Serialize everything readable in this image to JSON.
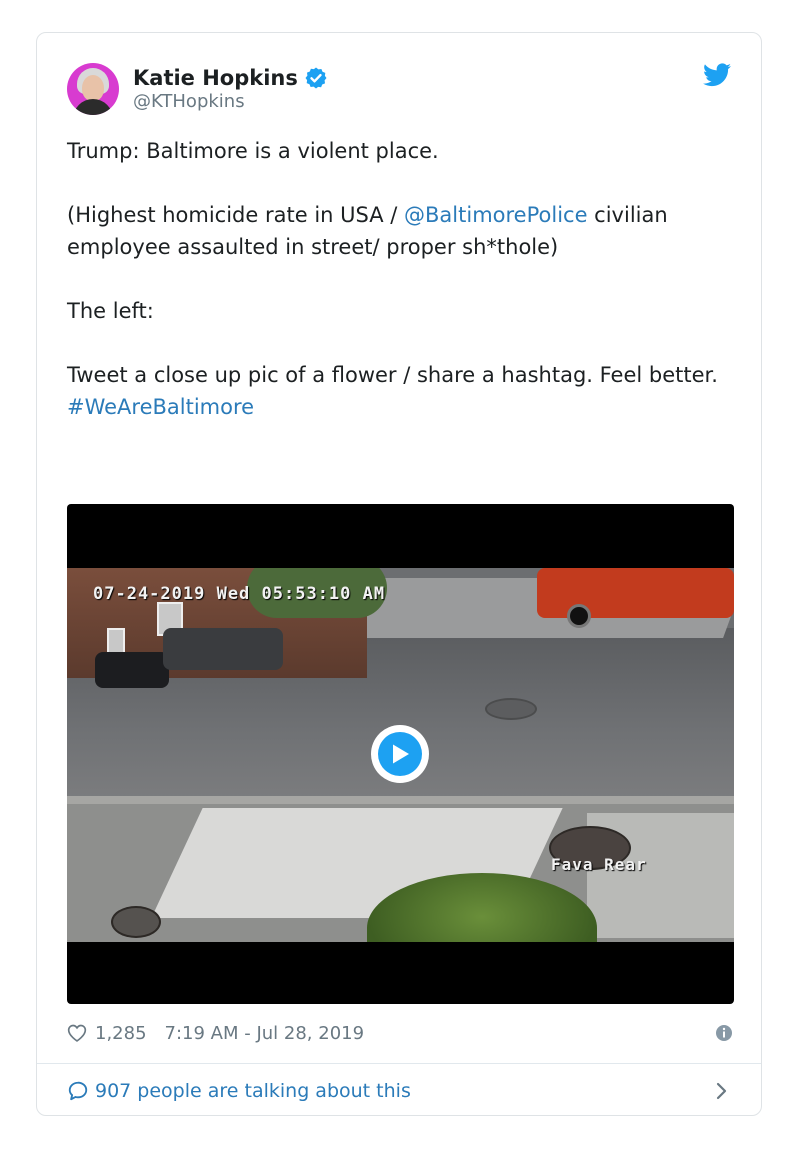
{
  "tweet": {
    "author": {
      "display_name": "Katie Hopkins",
      "handle": "@KTHopkins",
      "verified": true,
      "avatar_bg": "#d83bd0"
    },
    "text": {
      "line1": "Trump: Baltimore is a violent place.",
      "para2_prefix": "(Highest homicide rate in USA /  ",
      "para2_mention": "@BaltimorePolice",
      "para2_suffix": " civilian employee assaulted in street/ proper sh*thole)",
      "para3": "The left:",
      "para4_prefix": "Tweet a close up pic of a flower / share a hashtag. Feel better. ",
      "para4_hashtag": "#WeAreBaltimore"
    },
    "media": {
      "timestamp_overlay": "07-24-2019 Wed 05:53:10 AM",
      "camera_label": "Fava Rear"
    },
    "meta": {
      "likes": "1,285",
      "posted_at": "7:19 AM - Jul 28, 2019"
    },
    "footer": {
      "talking": "907 people are talking about this"
    }
  },
  "colors": {
    "link": "#2b7bb9",
    "brand_blue": "#1da1f2",
    "muted": "#697882"
  },
  "icons": [
    "verified-badge-icon",
    "twitter-bird-icon",
    "play-icon",
    "heart-icon",
    "info-icon",
    "comment-bubble-icon",
    "chevron-right-icon"
  ]
}
